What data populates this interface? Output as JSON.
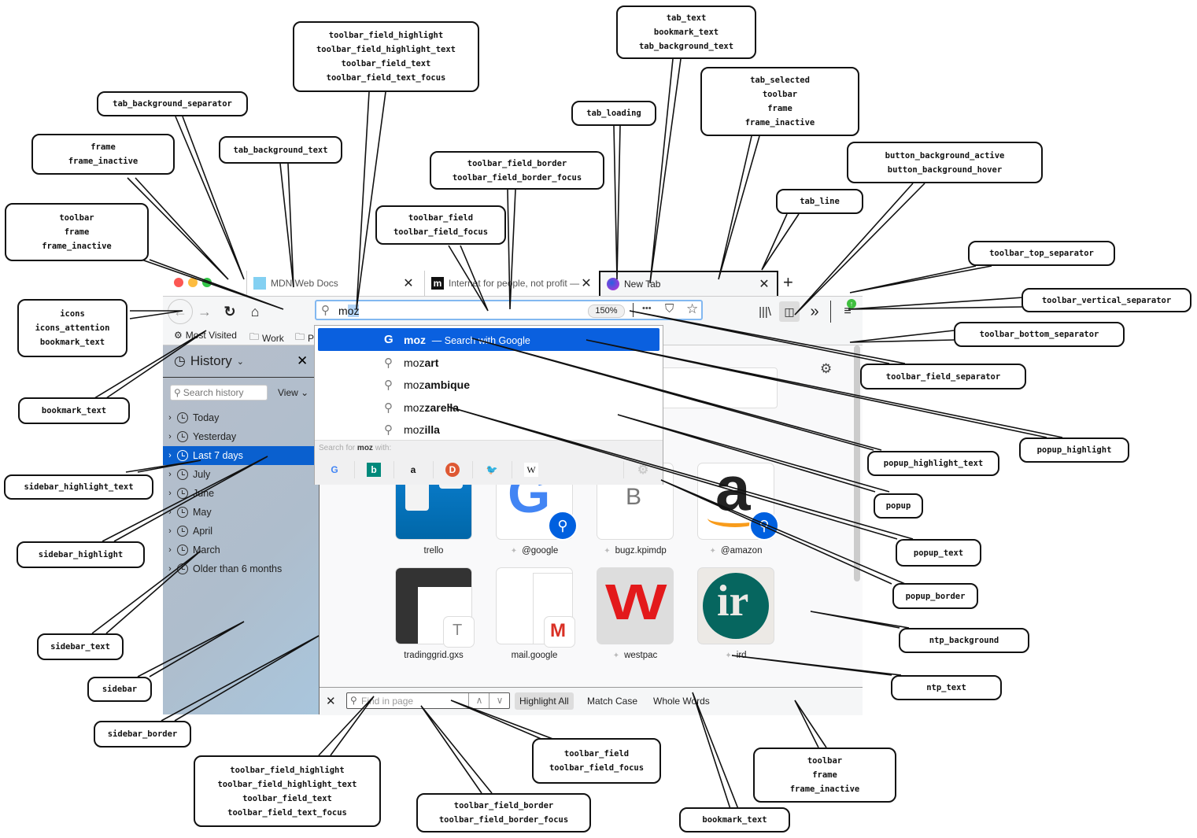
{
  "browser": {
    "tabs": [
      {
        "title": "MDN Web Docs",
        "favicon": "mdn-dino-icon",
        "selected": false
      },
      {
        "title": "Internet for people, not profit — ",
        "favicon": "mozilla-m-icon",
        "selected": false
      },
      {
        "title": "New Tab",
        "favicon": "firefox-icon",
        "selected": true
      }
    ],
    "close_glyph": "✕",
    "new_tab_glyph": "+",
    "urlbar": {
      "typed": "m",
      "highlighted": "oz",
      "zoom": "150%",
      "page_actions_glyph": "•••"
    },
    "bookmarks": [
      {
        "label": "Most Visited",
        "icon": "gear-icon"
      },
      {
        "label": "Work",
        "icon": "folder-icon"
      },
      {
        "label": "P",
        "icon": "folder-icon"
      }
    ],
    "colors": {
      "accent": "#0a60df",
      "sidebar_highlight": "#0a60cf",
      "urlbar_focus_border": "#82b8f0",
      "update_badge": "#3fbf3f"
    }
  },
  "sidebar": {
    "title": "History",
    "search_placeholder": "Search history",
    "view_label": "View",
    "items": [
      {
        "label": "Today",
        "selected": false
      },
      {
        "label": "Yesterday",
        "selected": false
      },
      {
        "label": "Last 7 days",
        "selected": true
      },
      {
        "label": "July",
        "selected": false
      },
      {
        "label": "June",
        "selected": false
      },
      {
        "label": "May",
        "selected": false
      },
      {
        "label": "April",
        "selected": false
      },
      {
        "label": "March",
        "selected": false
      },
      {
        "label": "Older than 6 months",
        "selected": false
      }
    ]
  },
  "popup": {
    "highlight": {
      "query": "moz",
      "suffix": "— Search with Google"
    },
    "suggestions": [
      {
        "prefix": "moz",
        "rest": "art"
      },
      {
        "prefix": "moz",
        "rest": "ambique"
      },
      {
        "prefix": "moz",
        "rest": "zarella"
      },
      {
        "prefix": "moz",
        "rest": "illa"
      }
    ],
    "search_for_prefix": "Search for ",
    "search_for_term": "moz",
    "search_for_suffix": " with:",
    "engines": [
      "Google",
      "Bing",
      "Amazon",
      "DuckDuckGo",
      "Twitter",
      "Wikipedia"
    ]
  },
  "newtab": {
    "tiles": [
      {
        "label": "trello",
        "pinned": false
      },
      {
        "label": "@google",
        "pinned": true
      },
      {
        "label": "bugz.kpimdp",
        "pinned": true
      },
      {
        "label": "@amazon",
        "pinned": true
      },
      {
        "label": "tradinggrid.gxs",
        "pinned": false
      },
      {
        "label": "mail.google",
        "pinned": false
      },
      {
        "label": "westpac",
        "pinned": true
      },
      {
        "label": "ird",
        "pinned": true
      }
    ],
    "tile_glyphs": {
      "bugz": "B",
      "tradinggrid": "T",
      "westpac": "W",
      "gmail": "M",
      "ird": "ir",
      "amazon": "a",
      "google": "G"
    }
  },
  "findbar": {
    "placeholder": "Find in page",
    "highlight_all": "Highlight All",
    "match_case": "Match Case",
    "whole_words": "Whole Words"
  },
  "annotations": {
    "toolbar_field_top": [
      "toolbar_field_highlight",
      "toolbar_field_highlight_text",
      "toolbar_field_text",
      "toolbar_field_text_focus"
    ],
    "tab_background_separator": [
      "tab_background_separator"
    ],
    "frame": [
      "frame",
      "frame_inactive"
    ],
    "tab_background_text": [
      "tab_background_text"
    ],
    "toolbar_frame_left": [
      "toolbar",
      "frame",
      "frame_inactive"
    ],
    "icons": [
      "icons",
      "icons_attention",
      "bookmark_text"
    ],
    "bookmark_text_left": [
      "bookmark_text"
    ],
    "toolbar_field_border_top": [
      "toolbar_field_border",
      "toolbar_field_border_focus"
    ],
    "toolbar_field_top2": [
      "toolbar_field",
      "toolbar_field_focus"
    ],
    "tab_loading": [
      "tab_loading"
    ],
    "tab_text": [
      "tab_text",
      "bookmark_text",
      "tab_background_text"
    ],
    "tab_selected": [
      "tab_selected",
      "toolbar",
      "frame",
      "frame_inactive"
    ],
    "button_background": [
      "button_background_active",
      "button_background_hover"
    ],
    "tab_line": [
      "tab_line"
    ],
    "toolbar_top_separator": [
      "toolbar_top_separator"
    ],
    "toolbar_vertical_separator": [
      "toolbar_vertical_separator"
    ],
    "toolbar_bottom_separator": [
      "toolbar_bottom_separator"
    ],
    "toolbar_field_separator": [
      "toolbar_field_separator"
    ],
    "popup_highlight_text": [
      "popup_highlight_text"
    ],
    "popup_highlight": [
      "popup_highlight"
    ],
    "popup": [
      "popup"
    ],
    "popup_text": [
      "popup_text"
    ],
    "popup_border": [
      "popup_border"
    ],
    "ntp_background": [
      "ntp_background"
    ],
    "ntp_text": [
      "ntp_text"
    ],
    "sidebar_highlight_text": [
      "sidebar_highlight_text"
    ],
    "sidebar_highlight": [
      "sidebar_highlight"
    ],
    "sidebar_text": [
      "sidebar_text"
    ],
    "sidebar": [
      "sidebar"
    ],
    "sidebar_border": [
      "sidebar_border"
    ],
    "find_field_highlight": [
      "toolbar_field_highlight",
      "toolbar_field_highlight_text",
      "toolbar_field_text",
      "toolbar_field_text_focus"
    ],
    "find_field_border": [
      "toolbar_field_border",
      "toolbar_field_border_focus"
    ],
    "find_field": [
      "toolbar_field",
      "toolbar_field_focus"
    ],
    "find_bookmark_text": [
      "bookmark_text"
    ],
    "find_toolbar": [
      "toolbar",
      "frame",
      "frame_inactive"
    ]
  }
}
